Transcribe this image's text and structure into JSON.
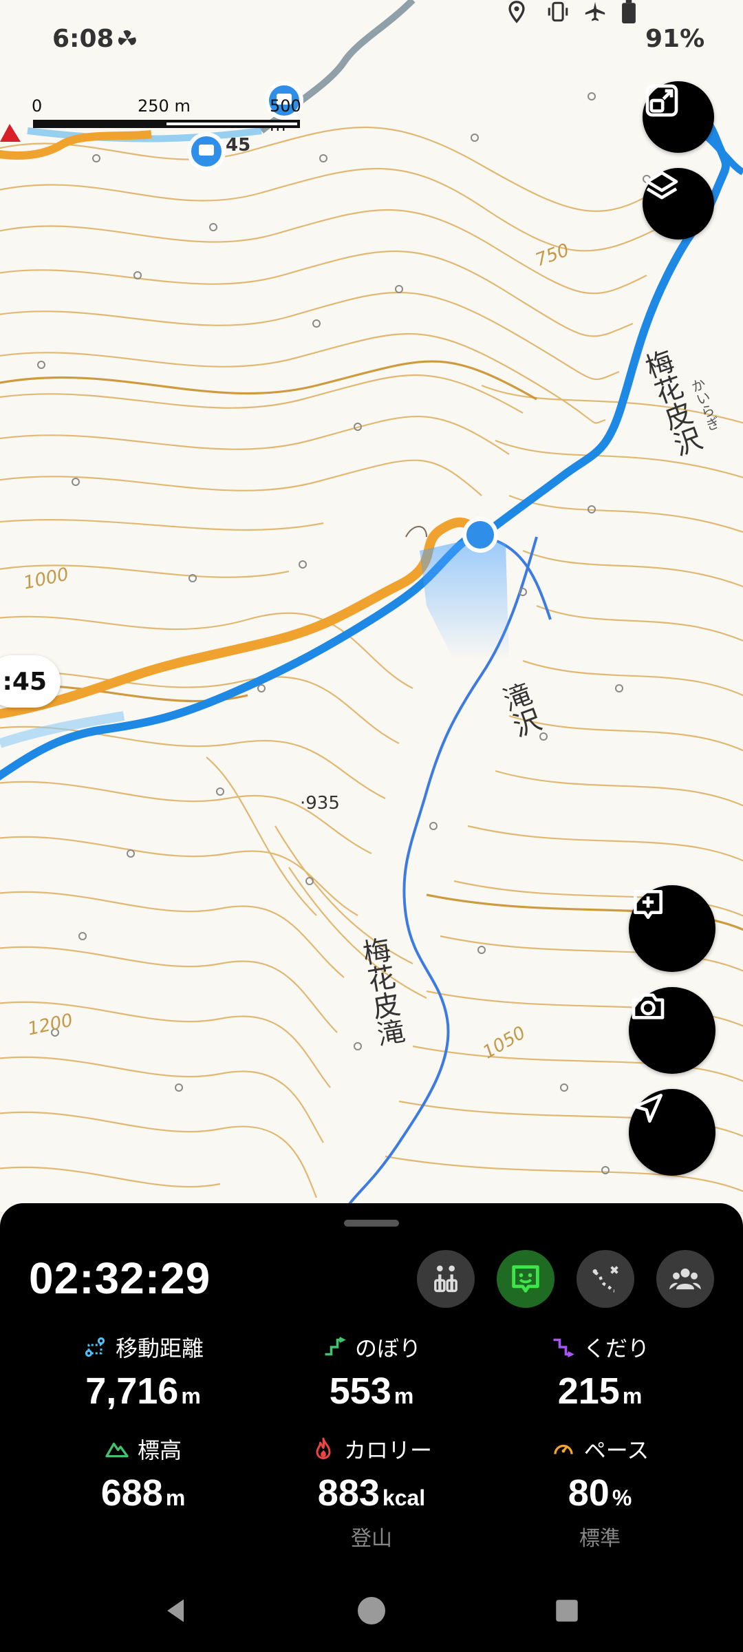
{
  "status_bar": {
    "time": "6:08",
    "battery_percent": "91%",
    "icons": [
      "fan-icon",
      "location-icon",
      "vibrate-icon",
      "airplane-icon",
      "battery-icon"
    ]
  },
  "map": {
    "scale": {
      "zero": "0",
      "mid": "250 m",
      "end": "500 m"
    },
    "elevation_labels": [
      "750",
      "1000",
      "935",
      "1200",
      "1050"
    ],
    "spot_height": "·935",
    "place_names": {
      "stream_upper": "梅花皮沢",
      "stream_upper_kana": "かいらぎ",
      "stream_side": "滝沢",
      "waterfall": "梅花皮滝"
    },
    "route_label_fragment": "45",
    "time_bubble": ":45",
    "colors": {
      "contour": "#d9a441",
      "route": "#f0a22e",
      "track": "#1e88e5",
      "stream": "#3d7be0"
    }
  },
  "fabs": [
    "expand-map-button",
    "layers-button",
    "add-note-button",
    "camera-button",
    "navigate-button"
  ],
  "panel": {
    "elapsed_time": "02:32:29",
    "tools": [
      "checkpoint-tool",
      "comment-tool",
      "route-edit-tool",
      "group-tool"
    ],
    "stats": [
      {
        "key": "distance",
        "label": "移動距離",
        "value": "7,716",
        "unit": "m",
        "icon": "distance-icon",
        "icon_color": "#4fc3f7"
      },
      {
        "key": "ascent",
        "label": "のぼり",
        "value": "553",
        "unit": "m",
        "icon": "ascent-icon",
        "icon_color": "#43c16f"
      },
      {
        "key": "descent",
        "label": "くだり",
        "value": "215",
        "unit": "m",
        "icon": "descent-icon",
        "icon_color": "#a855f7"
      },
      {
        "key": "elevation",
        "label": "標高",
        "value": "688",
        "unit": "m",
        "icon": "mountain-icon",
        "icon_color": "#43c16f"
      },
      {
        "key": "calories",
        "label": "カロリー",
        "value": "883",
        "unit": "kcal",
        "sub": "登山",
        "icon": "flame-icon",
        "icon_color": "#ef4444"
      },
      {
        "key": "pace",
        "label": "ペース",
        "value": "80",
        "unit": "%",
        "sub": "標準",
        "icon": "gauge-icon",
        "icon_color": "#f5a623"
      }
    ]
  },
  "nav": [
    "back-button",
    "home-button",
    "recents-button"
  ]
}
